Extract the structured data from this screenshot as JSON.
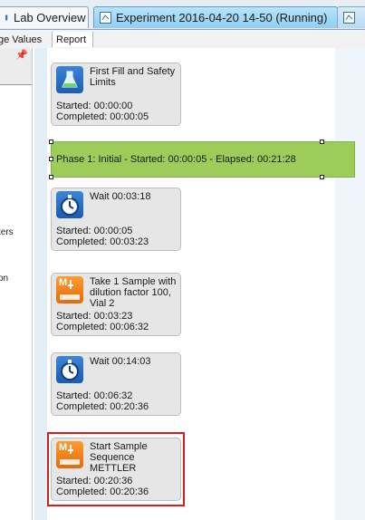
{
  "tabs": [
    {
      "label": "Lab Overview"
    },
    {
      "label": "Experiment 2016-04-20 14-50 (Running)"
    }
  ],
  "subtabs": [
    {
      "label": "ge Values"
    },
    {
      "label": "Report"
    }
  ],
  "left_panel": {
    "fragments": [
      "ters",
      "on"
    ]
  },
  "phase": {
    "label": "Phase 1: Initial - Started: 00:00:05 - Elapsed: 00:21:28",
    "color": "#9dcc5a"
  },
  "steps": [
    {
      "icon": "flask-icon",
      "title": "First Fill and Safety Limits",
      "started": "Started: 00:00:00",
      "completed": "Completed: 00:00:05"
    },
    {
      "icon": "stopwatch-icon",
      "title": "Wait 00:03:18",
      "started": "Started: 00:00:05",
      "completed": "Completed: 00:03:23"
    },
    {
      "icon": "sampler-icon",
      "title": "Take 1 Sample with dilution factor 100, Vial 2",
      "started": "Started: 00:03:23",
      "completed": "Completed: 00:06:32"
    },
    {
      "icon": "stopwatch-icon",
      "title": "Wait 00:14:03",
      "started": "Started: 00:06:32",
      "completed": "Completed: 00:20:36"
    },
    {
      "icon": "sampler-icon",
      "title": "Start Sample Sequence METTLER",
      "started": "Started: 00:20:36",
      "completed": "Completed: 00:20:36",
      "selected": true
    }
  ],
  "colors": {
    "selection": "#d81c1c",
    "active_tab": "#8fcff2"
  }
}
